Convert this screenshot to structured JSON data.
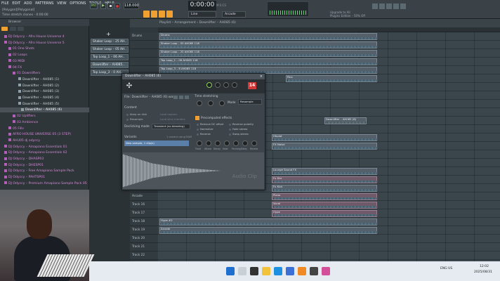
{
  "menu": [
    "FILE",
    "EDIT",
    "ADD",
    "PATTERNS",
    "VIEW",
    "OPTIONS",
    "TOOLS",
    "HELP"
  ],
  "hint_title": "[Polygon][Polygonal]",
  "hint_sub": "Time stretch clones · 0:00:00",
  "transport": {
    "pat_label": "PAT",
    "tempo": "118.000",
    "time": "0:00:00",
    "time_unit": "M:S:CS",
    "snap": "Line",
    "arcade": "Arcade"
  },
  "news": {
    "line1": "Upgrade to All",
    "line2": "Plugins Edition – 50% Off"
  },
  "colors": {
    "accent": "#f0a030",
    "play": "#9fe06a",
    "danger": "#d23a3a",
    "selected_variant": "#5a7fa8"
  },
  "browser": {
    "title": "Browser",
    "items": [
      {
        "label": "DJ Odyccy – Afro House Universe 4",
        "style": "pink",
        "indent": 6
      },
      {
        "label": "DJ Odyccy – Afro House Universe 5",
        "style": "pink",
        "indent": 6
      },
      {
        "label": "01 One Shots",
        "style": "pink",
        "indent": 12
      },
      {
        "label": "02 Loops",
        "style": "pink",
        "indent": 12
      },
      {
        "label": "03 MIDI",
        "style": "pink",
        "indent": 12
      },
      {
        "label": "04 FX",
        "style": "pink",
        "indent": 12
      },
      {
        "label": "01 Downlifters",
        "style": "pink",
        "indent": 18
      },
      {
        "label": "Downlifter – AH085 (1)",
        "style": "white",
        "indent": 26
      },
      {
        "label": "Downlifter – AH085 (2)",
        "style": "white",
        "indent": 26
      },
      {
        "label": "Downlifter – AH085 (3)",
        "style": "white",
        "indent": 26
      },
      {
        "label": "Downlifter – AH085 (4)",
        "style": "white",
        "indent": 26
      },
      {
        "label": "Downlifter – AH085 (5)",
        "style": "white",
        "indent": 26
      },
      {
        "label": "Downlifter – AH085 (6)",
        "style": "sel",
        "indent": 30
      },
      {
        "label": "02 Uplifters",
        "style": "pink",
        "indent": 18
      },
      {
        "label": "03 Ambience",
        "style": "pink",
        "indent": 18
      },
      {
        "label": "05 Fills",
        "style": "pink",
        "indent": 12
      },
      {
        "label": "AFRO HOUSE UNIVERSE 05 (3 STEP)",
        "style": "pink",
        "indent": 12
      },
      {
        "label": "AHU05 dj odyccy",
        "style": "pink",
        "indent": 12
      },
      {
        "label": "DJ Odyccy – Amapiano Essentials 01",
        "style": "pink",
        "indent": 6
      },
      {
        "label": "DJ Odyccy – Amapiano Essentials 02",
        "style": "pink",
        "indent": 6
      },
      {
        "label": "DJ Odyccy – DHASP03",
        "style": "pink",
        "indent": 6
      },
      {
        "label": "DJ Odyccy – DHESP01",
        "style": "pink",
        "indent": 6
      },
      {
        "label": "DJ Odyccy – Free Amapiano Sample Pack",
        "style": "pink",
        "indent": 6
      },
      {
        "label": "DJ Odyccy – PAHTSP01",
        "style": "pink",
        "indent": 6
      },
      {
        "label": "DJ Odyccy – Premium Amapiano Sample Pack 05",
        "style": "pink",
        "indent": 6
      }
    ]
  },
  "rack": {
    "rows": [
      "Shaker Loop – 25 AH..",
      "Shaker Loop – 05 AH..",
      "Top Loop_1 – 06 AH..",
      "Downlifter – AH085..",
      "Top Loop_3 – 0 AH.."
    ]
  },
  "playlist": {
    "title": "Playlist – Arrangement › Downlifter – AH085 (6)",
    "tracks": [
      "Drums",
      "",
      "",
      "",
      "",
      "",
      "",
      "",
      "",
      "",
      "",
      "",
      "",
      "",
      "",
      "",
      "",
      "",
      "Hype #2",
      "Arcade",
      "Track 16",
      "Track 17",
      "Track 18",
      "Track 19",
      "Track 20",
      "Track 21",
      "Track 22"
    ],
    "clips": [
      {
        "label": "Drums",
        "row": 0,
        "start": 0,
        "len": 310,
        "style": "gray"
      },
      {
        "label": "Shaker Loop – 05 AH085 118",
        "row": 1,
        "start": 0,
        "len": 310,
        "style": "gray"
      },
      {
        "label": "Shaker Loop – 25 AH085 118",
        "row": 2,
        "start": 0,
        "len": 310,
        "style": "gray"
      },
      {
        "label": "Top Loop_1 – 06 AH085 118",
        "row": 3,
        "start": 0,
        "len": 310,
        "style": "gray"
      },
      {
        "label": "Top Loop_3 – 8 AH085 118",
        "row": 4,
        "start": 0,
        "len": 310,
        "style": "gray"
      },
      {
        "label": "Perc",
        "row": 5,
        "start": 180,
        "len": 130,
        "style": "gray"
      },
      {
        "label": "Downlifter – AH085 (6)",
        "row": 10,
        "start": 235,
        "len": 60,
        "style": "gray"
      },
      {
        "label": "Hhplot",
        "row": 12,
        "start": 160,
        "len": 150,
        "style": "gray"
      },
      {
        "label": "FX Noise",
        "row": 13,
        "start": 160,
        "len": 150,
        "style": "gray"
      },
      {
        "label": "Lounge Sound FX",
        "row": 16,
        "start": 160,
        "len": 150,
        "style": "gray"
      },
      {
        "label": "Fx Dnr",
        "row": 17,
        "start": 160,
        "len": 150,
        "style": "pink"
      },
      {
        "label": "Fx Kick",
        "row": 18,
        "start": 160,
        "len": 150,
        "style": "gray"
      },
      {
        "label": "Piano",
        "row": 19,
        "start": 160,
        "len": 150,
        "style": "pink"
      },
      {
        "label": "Vocal",
        "row": 20,
        "start": 160,
        "len": 150,
        "style": "pink"
      },
      {
        "label": "Hype",
        "row": 21,
        "start": 160,
        "len": 150,
        "style": "pink"
      },
      {
        "label": "Hype #2",
        "row": 22,
        "start": 0,
        "len": 310,
        "style": "gray"
      },
      {
        "label": "Arcade",
        "row": 23,
        "start": 0,
        "len": 310,
        "style": "gray"
      }
    ]
  },
  "plugin": {
    "title": "Downlifter – AH085 (6)",
    "file_label": "File: Downlifter – AH085 (6).wav",
    "content_label": "Content",
    "keep_on_disk": "Keep on disk",
    "resample": "Resample",
    "load_regions": "Load regions",
    "load_slice": "Load slice markers",
    "declick_label": "Declicking mode",
    "declick_value": "Transient (no bleeding)",
    "time_stretch_label": "Time stretching",
    "mode_label": "Mode",
    "mode_value": "Resample",
    "precomputed": "Precomputed effects",
    "options": [
      "Remove DC offset",
      "Normalize",
      "Reverse",
      "Reverse polarity",
      "Fade stereo",
      "Swap stereo"
    ],
    "variants_label": "Variants",
    "variants_count": "1 variant using RAM",
    "variant_selected": "New sample, 1 clip(s)",
    "knobs": [
      "Pitch",
      "Mul",
      "Time",
      "Fine",
      "Track",
      "Attack",
      "Decay",
      "Fade",
      "Panning",
      "Delay",
      "Reverb"
    ],
    "track_number": "14",
    "wave_label": "Audio Clip"
  },
  "taskbar": {
    "tray": "ENG  US",
    "clock": "12:02",
    "date": "2025/08/31"
  }
}
